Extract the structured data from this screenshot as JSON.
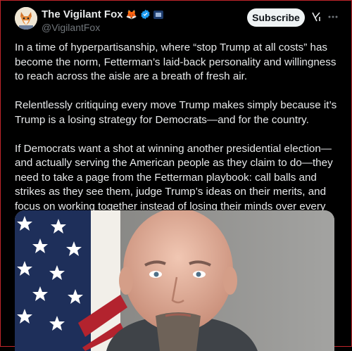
{
  "post": {
    "display_name": "The Vigilant Fox",
    "name_emoji": "🦊",
    "handle": "@VigilantFox",
    "subscribe_label": "Subscribe",
    "paragraphs": [
      "In a time of hyperpartisanship, where “stop Trump at all costs” has become the norm, Fetterman’s laid-back personality and willingness to reach across the aisle are a breath of fresh air.",
      "Relentlessly critiquing every move Trump makes simply because it’s Trump is a losing strategy for Democrats—and for the country.",
      "If Democrats want a shot at winning another presidential election—and actually serving the American people as they claim to do—they need to take a page from the Fetterman playbook: call balls and strikes as they see them, judge Trump’s ideas on their merits, and focus on working together instead of losing their minds over every little thing."
    ]
  },
  "icons": {
    "verified": "verified-badge-icon",
    "affiliate": "affiliate-badge-icon",
    "grok": "grok-icon",
    "more": "more-icon"
  },
  "colors": {
    "background": "#000000",
    "text": "#e7e9ea",
    "secondary_text": "#71767b",
    "verified": "#1d9bf0",
    "subscribe_bg": "#eff3f4"
  }
}
